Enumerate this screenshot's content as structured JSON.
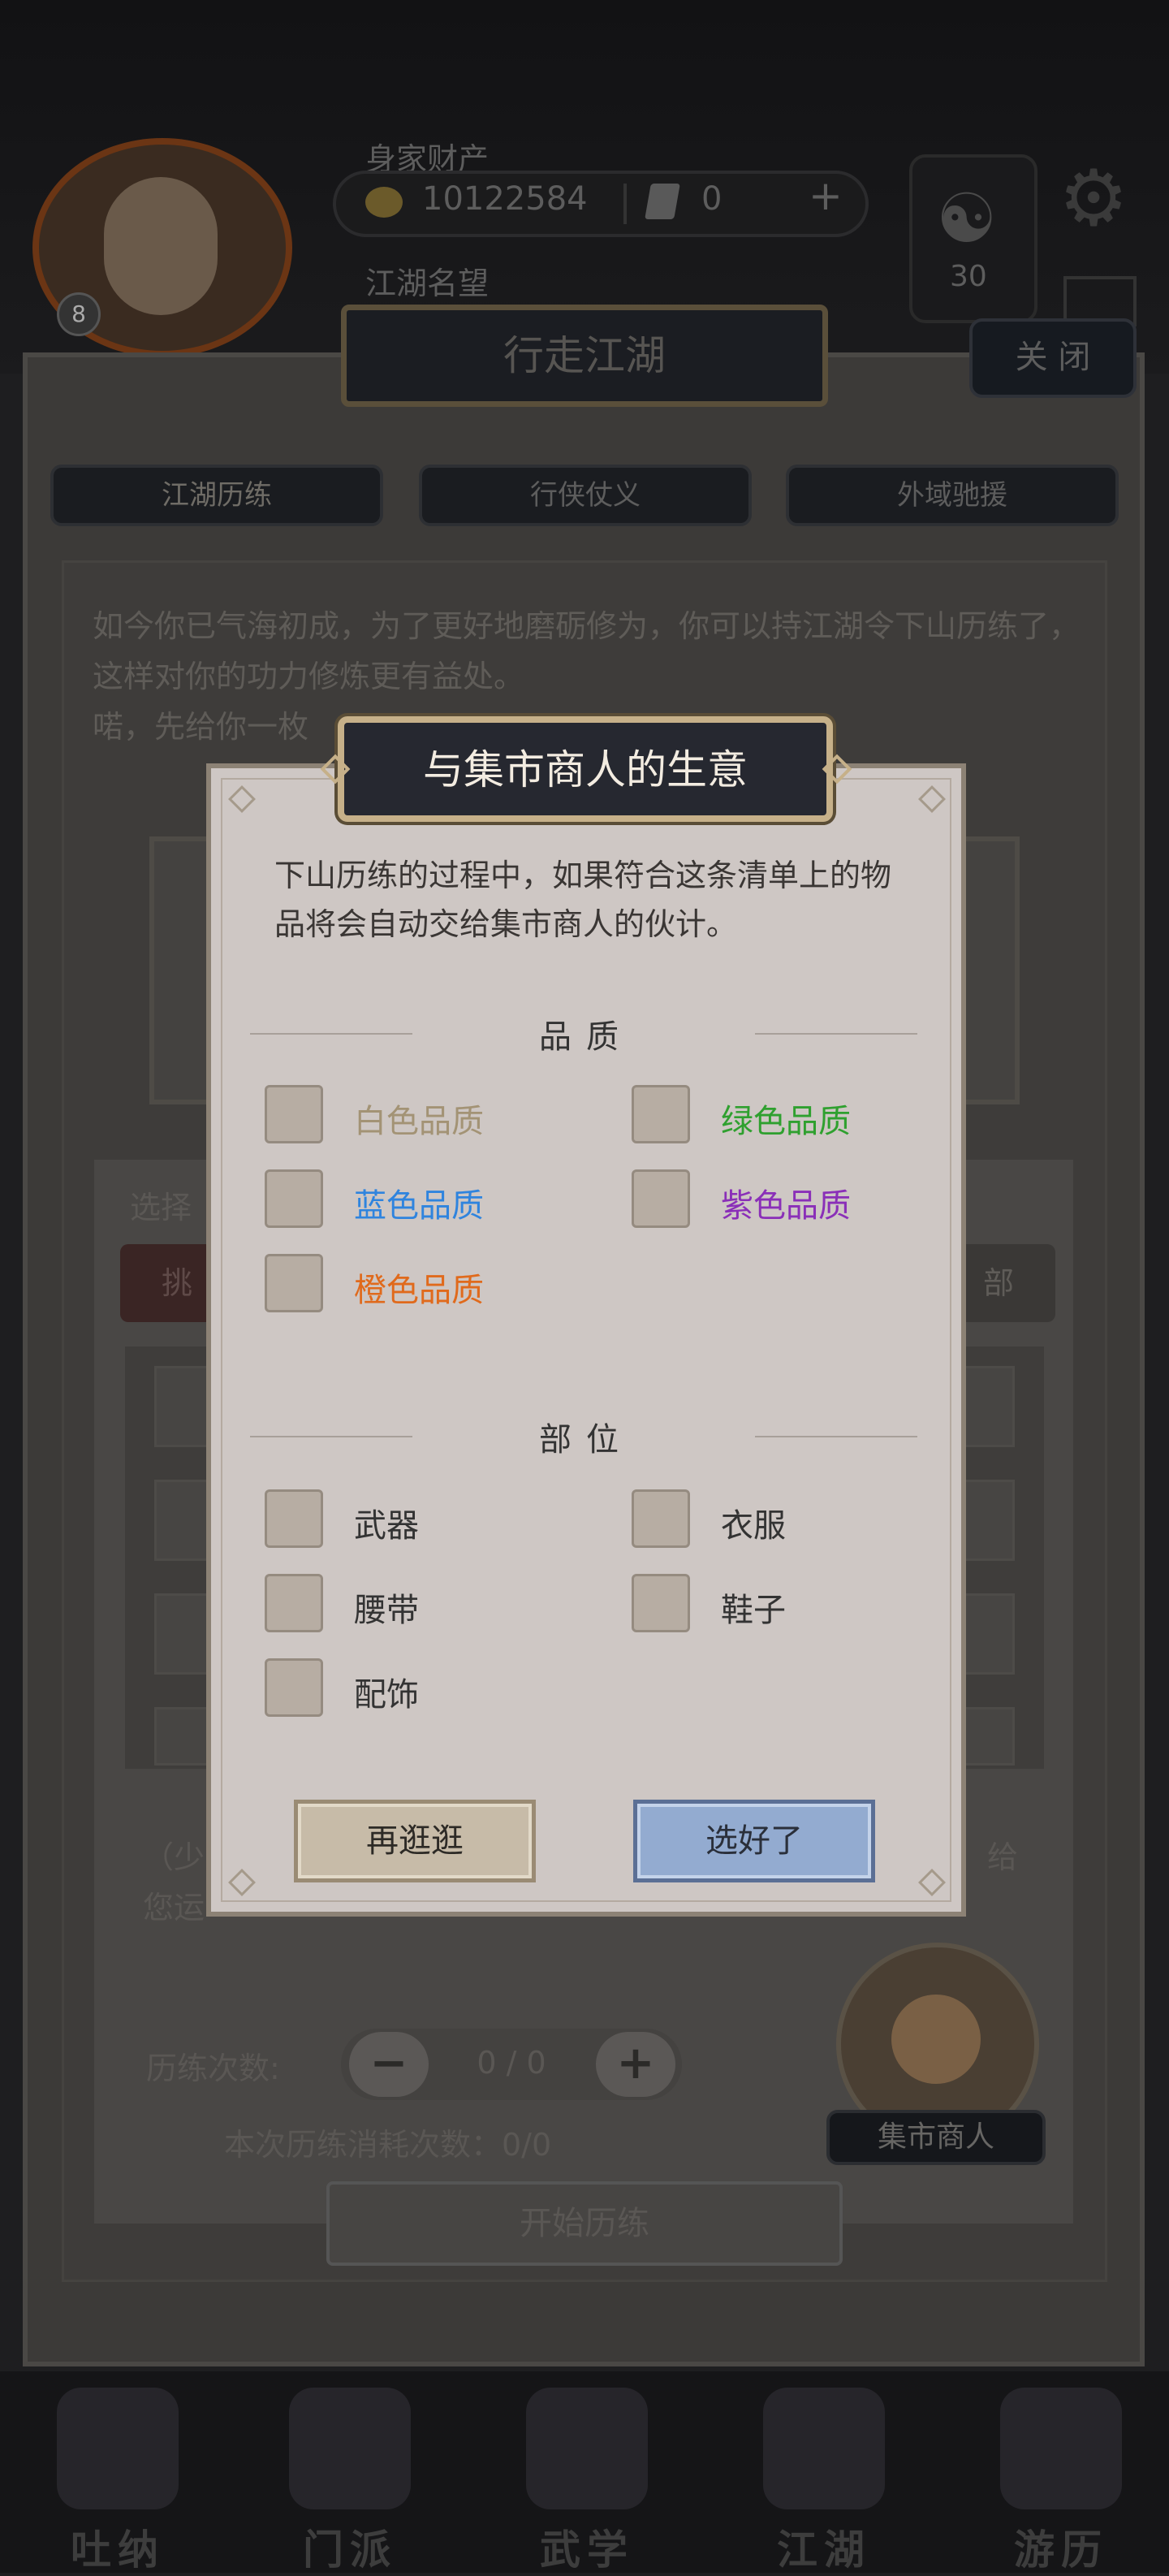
{
  "header": {
    "wealth_label": "身家财产",
    "coins": "10122584",
    "tokens": "0",
    "plus": "+",
    "fame_label": "江湖名望",
    "level": "8",
    "yin_yang_count": "30",
    "yin_yang_symbol": "☯",
    "gear_symbol": "⚙"
  },
  "main_dialog": {
    "title": "行走江湖",
    "close_label": "关 闭",
    "tabs": [
      "江湖历练",
      "行侠仗义",
      "外域驰援"
    ],
    "intro_text": "如今你已气海初成，为了更好地磨砺修为，你可以持江湖令下山历练了，这样对你的功力修炼更有益处。\n喏，先给你一枚",
    "select_label": "选择",
    "left_chip": "挑",
    "right_chip": "部",
    "hint_text": "（少\n您运",
    "hint_tail": "给",
    "count_label": "历练次数:",
    "count_value": "0 / 0",
    "minus": "−",
    "plus": "+",
    "consume_text": "本次历练消耗次数：0/0",
    "merchant_label": "集市商人",
    "start_button": "开始历练"
  },
  "bottom_nav": [
    "吐纳",
    "门派",
    "武学",
    "江湖",
    "游历"
  ],
  "modal": {
    "title": "与集市商人的生意",
    "description": "下山历练的过程中，如果符合这条清单上的物品将会自动交给集市商人的伙计。",
    "quality_header": "品质",
    "quality_options": [
      "白色品质",
      "绿色品质",
      "蓝色品质",
      "紫色品质",
      "橙色品质"
    ],
    "part_header": "部位",
    "part_options": [
      "武器",
      "衣服",
      "腰带",
      "鞋子",
      "配饰"
    ],
    "cancel_button": "再逛逛",
    "confirm_button": "选好了"
  },
  "colors": {
    "white_quality": "#a39375",
    "green_quality": "#2fa02f",
    "blue_quality": "#2f84de",
    "purple_quality": "#8a2fb8",
    "orange_quality": "#e06a1c",
    "confirm_button_bg": "#93abd0"
  }
}
